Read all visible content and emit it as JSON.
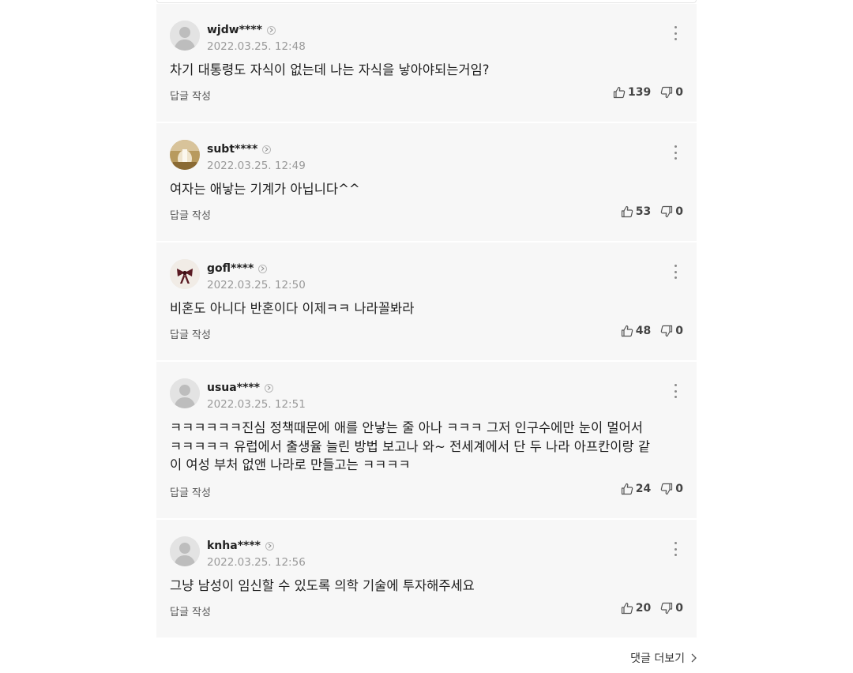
{
  "comments": [
    {
      "username": "wjdw****",
      "timestamp": "2022.03.25. 12:48",
      "text": "차기 대통령도 자식이 없는데 나는 자식을 낳아야되는거임?",
      "reply_label": "답글 작성",
      "likes": "139",
      "dislikes": "0",
      "avatar": "default-avatar-icon"
    },
    {
      "username": "subt****",
      "timestamp": "2022.03.25. 12:49",
      "text": "여자는 애낳는 기계가 아닙니다^^",
      "reply_label": "답글 작성",
      "likes": "53",
      "dislikes": "0",
      "avatar": "photo-avatar"
    },
    {
      "username": "gofl****",
      "timestamp": "2022.03.25. 12:50",
      "text": "비혼도 아니다 반혼이다 이제ㅋㅋ 나라꼴봐라",
      "reply_label": "답글 작성",
      "likes": "48",
      "dislikes": "0",
      "avatar": "ribbon-avatar"
    },
    {
      "username": "usua****",
      "timestamp": "2022.03.25. 12:51",
      "text": "ㅋㅋㅋㅋㅋㅋ진심 정책때문에 애를 안낳는 줄 아나 ㅋㅋㅋ 그저 인구수에만 눈이 멀어서\nㅋㅋㅋㅋㅋ 유럽에서 출생율 늘린 방법 보고나 와~ 전세계에서 단 두 나라 아프칸이랑 같\n이 여성 부처 없앤 나라로 만들고는 ㅋㅋㅋㅋ",
      "reply_label": "답글 작성",
      "likes": "24",
      "dislikes": "0",
      "avatar": "default-avatar-icon"
    },
    {
      "username": "knha****",
      "timestamp": "2022.03.25. 12:56",
      "text": "그냥 남성이 임신할 수 있도록 의학 기술에 투자해주세요",
      "reply_label": "답글 작성",
      "likes": "20",
      "dislikes": "0",
      "avatar": "default-avatar-icon"
    }
  ],
  "footer": {
    "more_comments_label": "댓글 더보기"
  },
  "colors": {
    "card_background": "#f7f7f7",
    "text_primary": "#1e1e1e",
    "text_secondary": "#9a9a9a"
  }
}
